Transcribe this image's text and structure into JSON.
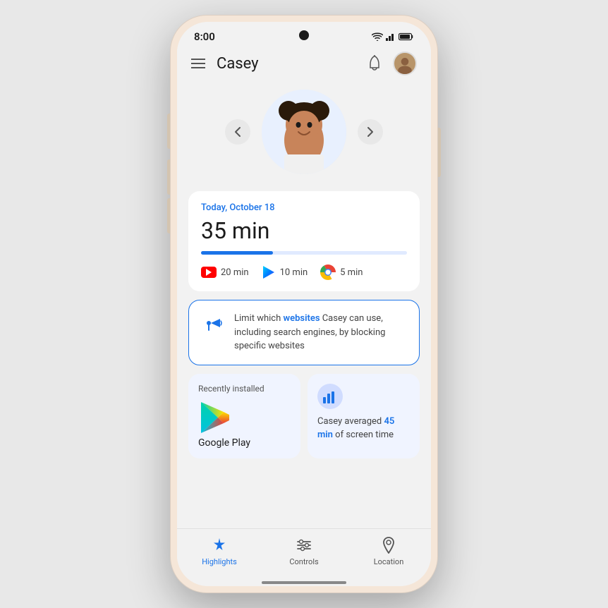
{
  "status": {
    "time": "8:00"
  },
  "header": {
    "title": "Casey",
    "bell_label": "notifications",
    "avatar_label": "parent avatar"
  },
  "profile": {
    "prev_label": "‹",
    "next_label": "›"
  },
  "screen_time": {
    "date": "Today, October 18",
    "value": "35 min",
    "progress_percent": 35,
    "apps": [
      {
        "name": "YouTube",
        "time": "20 min"
      },
      {
        "name": "Google Play",
        "time": "10 min"
      },
      {
        "name": "Chrome",
        "time": "5 min"
      }
    ]
  },
  "promo": {
    "text_prefix": "Limit which ",
    "text_bold": "websites",
    "text_suffix": " Casey can use, including search engines, by blocking specific websites"
  },
  "recently_installed": {
    "label": "Recently installed",
    "app_name": "Google Play"
  },
  "stats": {
    "text_prefix": "Casey averaged ",
    "highlight": "45 min",
    "text_suffix": " of screen time"
  },
  "bottom_nav": {
    "items": [
      {
        "id": "highlights",
        "label": "Highlights",
        "active": true
      },
      {
        "id": "controls",
        "label": "Controls",
        "active": false
      },
      {
        "id": "location",
        "label": "Location",
        "active": false
      }
    ]
  }
}
